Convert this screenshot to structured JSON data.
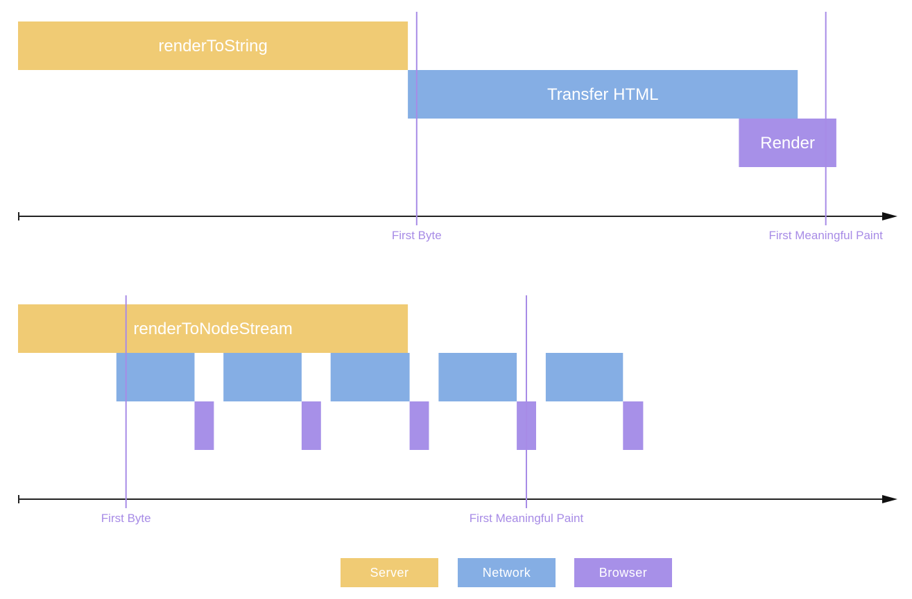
{
  "chart_data": {
    "type": "timeline",
    "title": "",
    "time_axis": {
      "range": [
        0,
        100
      ],
      "unit": "relative time",
      "label": ""
    },
    "colors": {
      "server": "#f0cb74",
      "network": "#85aee4",
      "browser": "#a790e8",
      "marker": "#a78be6",
      "axis": "#222222"
    },
    "diagrams": [
      {
        "id": "string",
        "lanes": [
          {
            "category": "server",
            "segments": [
              {
                "start": 0.0,
                "end": 44.4,
                "label": "renderToString"
              }
            ]
          },
          {
            "category": "network",
            "segments": [
              {
                "start": 44.4,
                "end": 88.8,
                "label": "Transfer HTML"
              }
            ]
          },
          {
            "category": "browser",
            "segments": [
              {
                "start": 82.1,
                "end": 93.2,
                "label": "Render"
              }
            ]
          }
        ],
        "markers": [
          {
            "label": "First Byte",
            "at": 45.4
          },
          {
            "label": "First Meaningful Paint",
            "at": 92.0
          }
        ]
      },
      {
        "id": "stream",
        "lanes": [
          {
            "category": "server",
            "segments": [
              {
                "start": 0.0,
                "end": 44.4,
                "label": "renderToNodeStream"
              }
            ]
          },
          {
            "category": "network",
            "segments": [
              {
                "start": 11.2,
                "end": 20.1,
                "label": ""
              },
              {
                "start": 23.4,
                "end": 32.3,
                "label": ""
              },
              {
                "start": 35.6,
                "end": 44.6,
                "label": ""
              },
              {
                "start": 47.9,
                "end": 56.8,
                "label": ""
              },
              {
                "start": 60.1,
                "end": 68.9,
                "label": ""
              }
            ]
          },
          {
            "category": "browser",
            "segments": [
              {
                "start": 20.1,
                "end": 22.3,
                "label": ""
              },
              {
                "start": 32.3,
                "end": 34.5,
                "label": ""
              },
              {
                "start": 44.6,
                "end": 46.8,
                "label": ""
              },
              {
                "start": 56.8,
                "end": 59.0,
                "label": ""
              },
              {
                "start": 68.9,
                "end": 71.2,
                "label": ""
              }
            ]
          }
        ],
        "markers": [
          {
            "label": "First Byte",
            "at": 12.3
          },
          {
            "label": "First Meaningful Paint",
            "at": 57.9
          }
        ]
      }
    ],
    "legend": {
      "placement": "bottom-center",
      "entries": [
        {
          "category": "server",
          "label": "Server"
        },
        {
          "category": "network",
          "label": "Network"
        },
        {
          "category": "browser",
          "label": "Browser"
        }
      ]
    }
  }
}
